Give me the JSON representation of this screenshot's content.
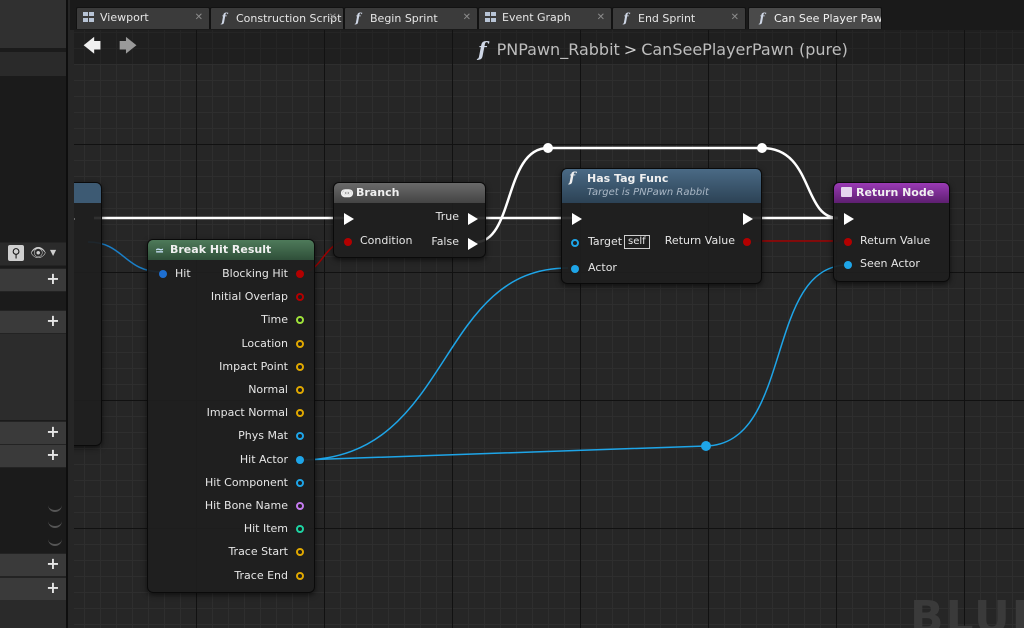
{
  "tabs": [
    {
      "label": "Viewport",
      "icon": "viewport-grid-icon"
    },
    {
      "label": "Construction Script",
      "icon": "function-icon"
    },
    {
      "label": "Begin Sprint",
      "icon": "function-icon"
    },
    {
      "label": "Event Graph",
      "icon": "viewport-grid-icon"
    },
    {
      "label": "End Sprint",
      "icon": "function-icon"
    },
    {
      "label": "Can See Player Paw",
      "icon": "function-icon"
    }
  ],
  "breadcrumb": {
    "blueprint": "PNPawn_Rabbit",
    "separator": ">",
    "function": "CanSeePlayerPawn (pure)"
  },
  "watermark": "BLUE",
  "nodes": {
    "branch": {
      "title": "Branch",
      "pins_in": [
        "Condition"
      ],
      "pins_out": [
        "True",
        "False"
      ]
    },
    "break_hit_result": {
      "title": "Break Hit Result",
      "pins_in": [
        "Hit"
      ],
      "pins_out": [
        "Blocking Hit",
        "Initial Overlap",
        "Time",
        "Location",
        "Impact Point",
        "Normal",
        "Impact Normal",
        "Phys Mat",
        "Hit Actor",
        "Hit Component",
        "Hit Bone Name",
        "Hit Item",
        "Trace Start",
        "Trace End"
      ]
    },
    "has_tag_func": {
      "title": "Has Tag Func",
      "subtitle": "Target is PNPawn Rabbit",
      "pins_in": [
        "Target",
        "Actor"
      ],
      "self_badge": "self",
      "pins_out": [
        "Return Value"
      ]
    },
    "return_node": {
      "title": "Return Node",
      "pins_in": [
        "Return Value",
        "Seen Actor"
      ]
    }
  },
  "colors": {
    "exec_wire": "#ffffff",
    "object_pin": "#1ea5e8",
    "bool_pin": "#b30000",
    "float_pin": "#9fe23a",
    "struct_pin": "#e0a800",
    "name_pin": "#c57bf0",
    "int_pin": "#1ed4a3",
    "function_header": "#3d5a73",
    "return_header": "#7a2a8f",
    "struct_header": "#3f6b4a",
    "branch_header": "#5a5a5a"
  }
}
